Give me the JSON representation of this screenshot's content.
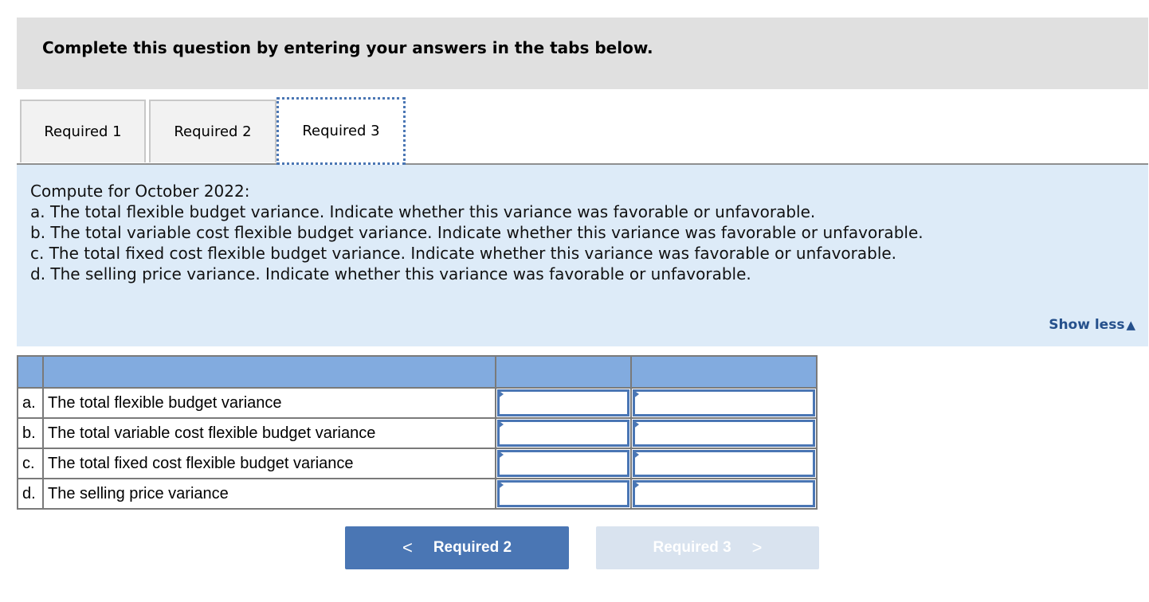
{
  "header": {
    "title": "Complete this question by entering your answers in the tabs below."
  },
  "tabs": [
    {
      "label": "Required 1",
      "active": false
    },
    {
      "label": "Required 2",
      "active": false
    },
    {
      "label": "Required 3",
      "active": true
    }
  ],
  "prompt": {
    "lines": [
      "Compute for October 2022:",
      "a. The total flexible budget variance. Indicate whether this variance was favorable or unfavorable.",
      "b. The total variable cost flexible budget variance. Indicate whether this variance was favorable or unfavorable.",
      "c. The total fixed cost flexible budget variance. Indicate whether this variance was favorable or unfavorable.",
      "d. The selling price variance. Indicate whether this variance was favorable or unfavorable."
    ],
    "show_less_label": "Show less",
    "show_less_icon": "triangle-up-icon"
  },
  "table": {
    "headers": [
      "",
      "",
      "",
      ""
    ],
    "rows": [
      {
        "letter": "a.",
        "description": "The total flexible budget variance",
        "amount": "",
        "type": ""
      },
      {
        "letter": "b.",
        "description": "The total variable cost flexible budget variance",
        "amount": "",
        "type": ""
      },
      {
        "letter": "c.",
        "description": "The total fixed cost flexible budget variance",
        "amount": "",
        "type": ""
      },
      {
        "letter": "d.",
        "description": "The selling price variance",
        "amount": "",
        "type": ""
      }
    ]
  },
  "navigation": {
    "prev_label": "Required 2",
    "prev_icon": "chevron-left-icon",
    "next_label": "Required 3",
    "next_icon": "chevron-right-icon",
    "next_disabled": true
  },
  "colors": {
    "accent": "#4a76b4",
    "prompt_bg": "#ddebf8",
    "table_header": "#82abdf",
    "header_bg": "#e0e0e0",
    "link": "#25508c"
  }
}
